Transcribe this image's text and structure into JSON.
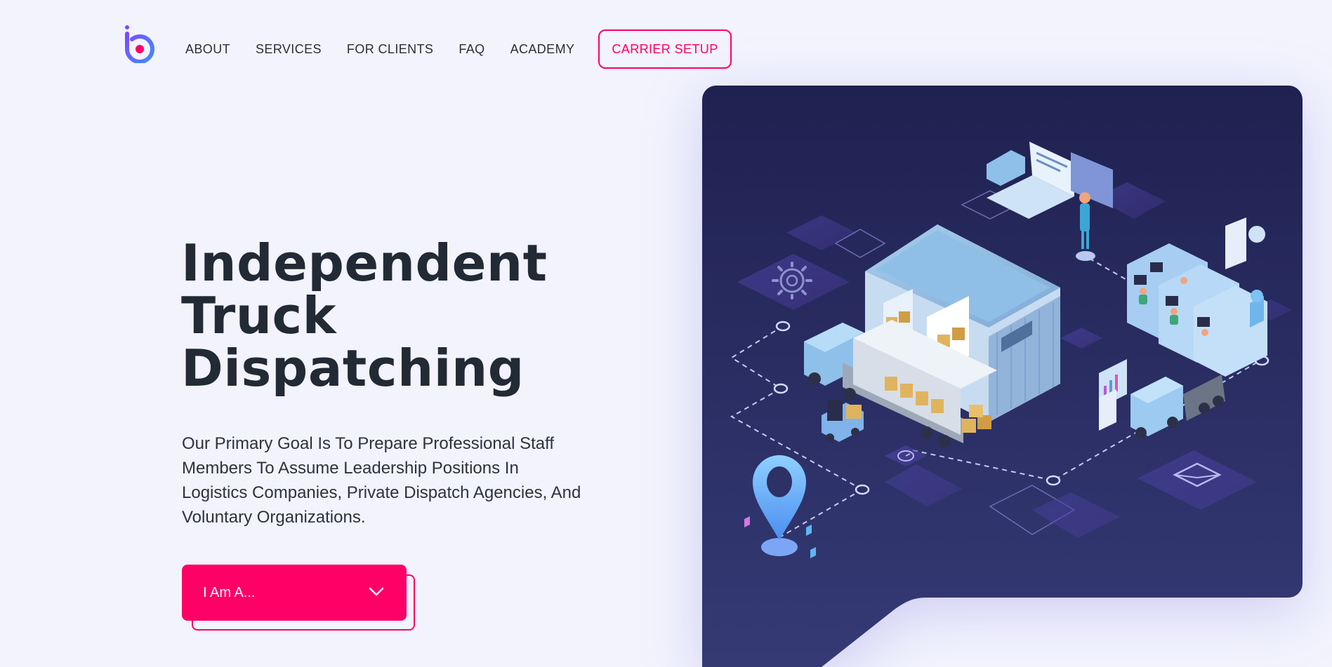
{
  "nav": {
    "logo_icon": "brand-logo-icon",
    "items": [
      {
        "label": "ABOUT"
      },
      {
        "label": "SERVICES"
      },
      {
        "label": "FOR CLIENTS"
      },
      {
        "label": "FAQ"
      },
      {
        "label": "ACADEMY"
      }
    ],
    "cta_label": "CARRIER SETUP"
  },
  "hero": {
    "title_lines": [
      "Independent",
      "Truck",
      "Dispatching"
    ],
    "description": "Our Primary Goal Is To Prepare Professional Staff Members To Assume Leadership Positions In Logistics Companies, Private Dispatch Agencies, And Voluntary Organizations.",
    "select": {
      "label": "I Am A...",
      "icon": "chevron-down-icon"
    }
  },
  "illustration": {
    "subject": "isometric logistics warehouse with trucks",
    "icons": [
      "gear-icon",
      "clock-icon",
      "mail-icon",
      "location-pin-icon",
      "laptop-icon",
      "chart-icon"
    ]
  },
  "colors": {
    "background": "#f2f3fd",
    "accent": "#ff0066",
    "text_dark": "#222a35",
    "panel_top": "#1f2150",
    "panel_bottom": "#353a75"
  }
}
